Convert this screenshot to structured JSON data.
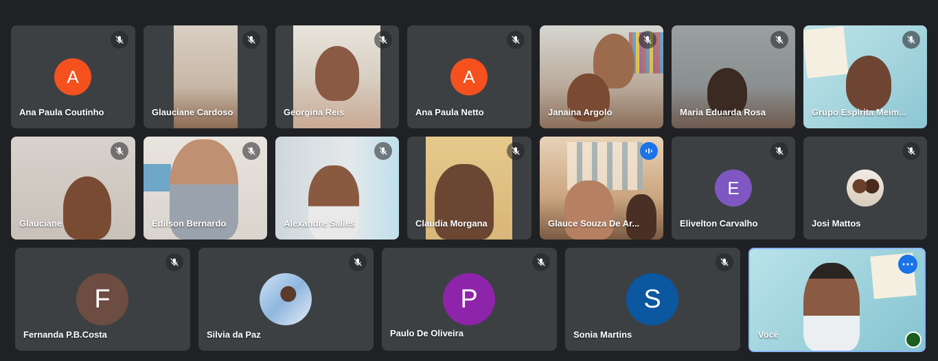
{
  "participants": [
    {
      "name": "Ana Paula Coutinho",
      "initial": "A",
      "avatar_color": "#f4511e"
    },
    {
      "name": "Glauciane Cardoso"
    },
    {
      "name": "Georgina Reis"
    },
    {
      "name": "Ana Paula Netto",
      "initial": "A",
      "avatar_color": "#f4511e"
    },
    {
      "name": "Janaina Argolo"
    },
    {
      "name": "Maria Eduarda Rosa"
    },
    {
      "name": "Grupo Espirita Meim..."
    },
    {
      "name": "Glauciane"
    },
    {
      "name": "Edilson Bernardo"
    },
    {
      "name": "Alexandre Salles"
    },
    {
      "name": "Claudia Morgana"
    },
    {
      "name": "Glauce Souza De Ar..."
    },
    {
      "name": "Elivelton Carvalho",
      "initial": "E",
      "avatar_color": "#7e57c2"
    },
    {
      "name": "Josi Mattos"
    },
    {
      "name": "Fernanda P.B.Costa",
      "initial": "F",
      "avatar_color": "#6d4c41"
    },
    {
      "name": "Silvia da Paz"
    },
    {
      "name": "Paulo De Oliveira",
      "initial": "P",
      "avatar_color": "#8e24aa"
    },
    {
      "name": "Sonia Martins",
      "initial": "S",
      "avatar_color": "#0b57a0"
    },
    {
      "name": "Você"
    }
  ],
  "icons": {
    "muted": "mic-off-icon",
    "speaking": "audio-wave-icon",
    "more": "more-options-icon"
  },
  "colors": {
    "background": "#202124",
    "tile": "#3c4043",
    "accent": "#1a73e8"
  }
}
